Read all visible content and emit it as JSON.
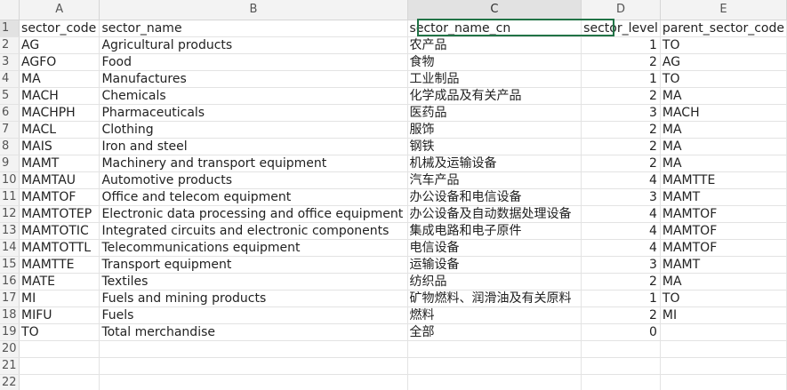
{
  "columns": [
    "A",
    "B",
    "C",
    "D",
    "E"
  ],
  "rows": [
    {
      "n": "1",
      "a": "sector_code",
      "b": "sector_name",
      "c": "sector_name_cn",
      "d": "sector_level",
      "e": "parent_sector_code"
    },
    {
      "n": "2",
      "a": "AG",
      "b": "Agricultural products",
      "c": "农产品",
      "d": "1",
      "e": "TO"
    },
    {
      "n": "3",
      "a": "AGFO",
      "b": "Food",
      "c": "食物",
      "d": "2",
      "e": "AG"
    },
    {
      "n": "4",
      "a": "MA",
      "b": "Manufactures",
      "c": "工业制品",
      "d": "1",
      "e": "TO"
    },
    {
      "n": "5",
      "a": "MACH",
      "b": "Chemicals",
      "c": "化学成品及有关产品",
      "d": "2",
      "e": "MA"
    },
    {
      "n": "6",
      "a": "MACHPH",
      "b": "Pharmaceuticals",
      "c": "医药品",
      "d": "3",
      "e": "MACH"
    },
    {
      "n": "7",
      "a": "MACL",
      "b": "Clothing",
      "c": "服饰",
      "d": "2",
      "e": "MA"
    },
    {
      "n": "8",
      "a": "MAIS",
      "b": "Iron and steel",
      "c": "钢铁",
      "d": "2",
      "e": "MA"
    },
    {
      "n": "9",
      "a": "MAMT",
      "b": "Machinery and transport equipment",
      "c": "机械及运输设备",
      "d": "2",
      "e": "MA"
    },
    {
      "n": "10",
      "a": "MAMTAU",
      "b": "Automotive products",
      "c": "汽车产品",
      "d": "4",
      "e": "MAMTTE"
    },
    {
      "n": "11",
      "a": "MAMTOF",
      "b": "Office and telecom equipment",
      "c": "办公设备和电信设备",
      "d": "3",
      "e": "MAMT"
    },
    {
      "n": "12",
      "a": "MAMTOTEP",
      "b": "Electronic data processing and office equipment",
      "c": "办公设备及自动数据处理设备",
      "d": "4",
      "e": "MAMTOF"
    },
    {
      "n": "13",
      "a": "MAMTOTIC",
      "b": "Integrated circuits and electronic components",
      "c": "集成电路和电子原件",
      "d": "4",
      "e": "MAMTOF"
    },
    {
      "n": "14",
      "a": "MAMTOTTL",
      "b": "Telecommunications equipment",
      "c": "电信设备",
      "d": "4",
      "e": "MAMTOF"
    },
    {
      "n": "15",
      "a": "MAMTTE",
      "b": "Transport equipment",
      "c": "运输设备",
      "d": "3",
      "e": "MAMT"
    },
    {
      "n": "16",
      "a": "MATE",
      "b": "Textiles",
      "c": "纺织品",
      "d": "2",
      "e": "MA"
    },
    {
      "n": "17",
      "a": "MI",
      "b": "Fuels and mining products",
      "c": "矿物燃料、润滑油及有关原料",
      "d": "1",
      "e": "TO"
    },
    {
      "n": "18",
      "a": "MIFU",
      "b": "Fuels",
      "c": "燃料",
      "d": "2",
      "e": "MI"
    },
    {
      "n": "19",
      "a": "TO",
      "b": "Total merchandise",
      "c": "全部",
      "d": "0",
      "e": ""
    },
    {
      "n": "20",
      "a": "",
      "b": "",
      "c": "",
      "d": "",
      "e": ""
    },
    {
      "n": "21",
      "a": "",
      "b": "",
      "c": "",
      "d": "",
      "e": ""
    },
    {
      "n": "22",
      "a": "",
      "b": "",
      "c": "",
      "d": "",
      "e": ""
    }
  ],
  "colors": {
    "selection_border": "#217346",
    "header_bg": "#f3f3f3",
    "header_selected_bg": "#e2e2e2",
    "gridline": "#e3e3e3"
  }
}
